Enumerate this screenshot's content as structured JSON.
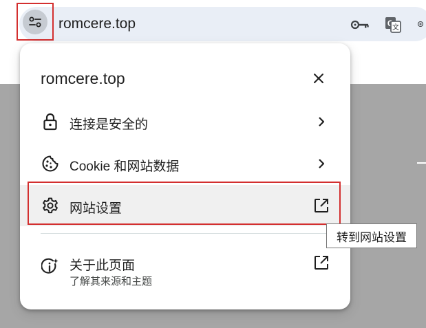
{
  "omnibox": {
    "url": "romcere.top"
  },
  "popup": {
    "title": "romcere.top",
    "items": [
      {
        "label": "连接是安全的"
      },
      {
        "label": "Cookie 和网站数据"
      },
      {
        "label": "网站设置"
      },
      {
        "label": "关于此页面",
        "sublabel": "了解其来源和主题"
      }
    ]
  },
  "tooltip": {
    "text": "转到网站设置"
  },
  "colors": {
    "highlight": "#d32f2f",
    "omnibox_bg": "#e9eef6",
    "page_bg": "#a6a6a6",
    "hover_row": "#f0f0f0"
  },
  "icons": {
    "site_info": "tune-icon",
    "toolbar": [
      "key-icon",
      "translate-icon",
      "zoom-icon"
    ],
    "rows": [
      "lock-icon",
      "cookie-icon",
      "gear-icon",
      "info-sparkle-icon"
    ],
    "trailing": [
      "chevron-right-icon",
      "chevron-right-icon",
      "open-external-icon",
      "open-external-icon"
    ],
    "close": "close-icon"
  }
}
